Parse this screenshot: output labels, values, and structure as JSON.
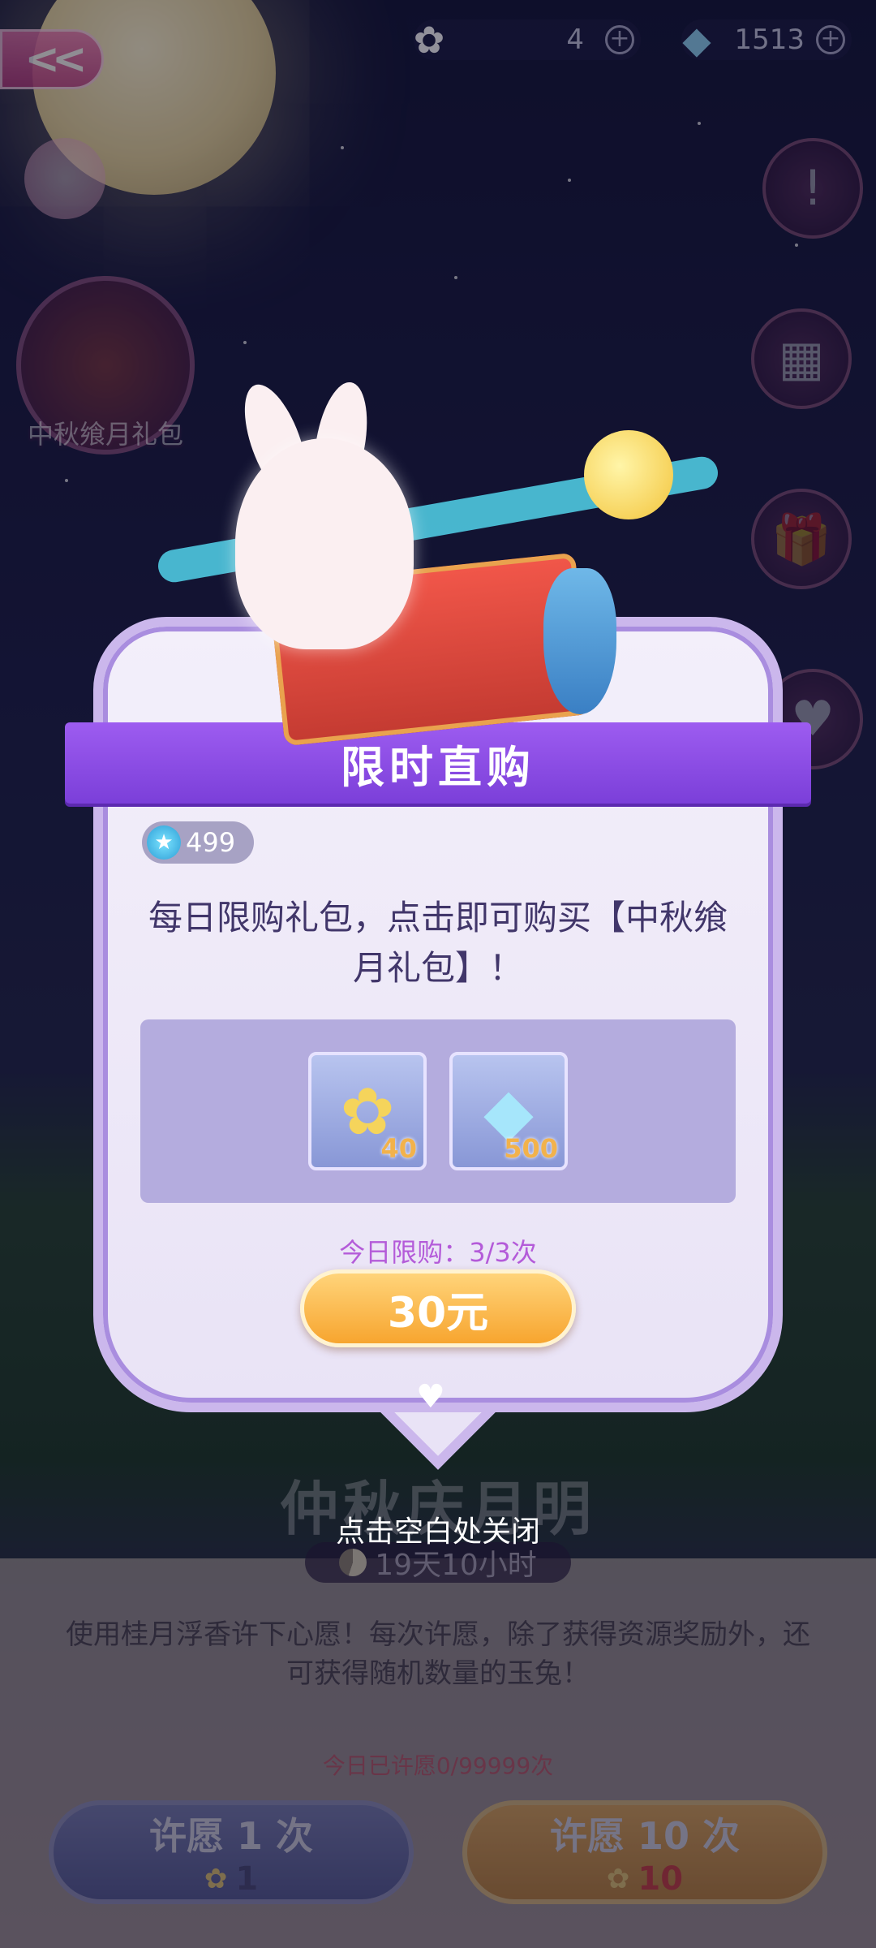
{
  "topbar": {
    "flower_count": "4",
    "gem_count": "1513",
    "flower_icon": "osmanthus-flower-icon",
    "gem_icon": "diamond-icon"
  },
  "side": {
    "gift_pack_label": "中秋飨月礼包"
  },
  "modal": {
    "title": "限时直购",
    "price_tag": "499",
    "description": "每日限购礼包，点击即可购买【中秋飨月礼包】！",
    "rewards": [
      {
        "icon": "osmanthus-flower-icon",
        "qty": "40"
      },
      {
        "icon": "diamond-icon",
        "qty": "500"
      }
    ],
    "limit_text": "今日限购：3/3次",
    "buy_label": "30元"
  },
  "close_hint": "点击空白处关闭",
  "event": {
    "title": "仲秋庆月明",
    "timer": "19天10小时",
    "description": "使用桂月浮香许下心愿！每次许愿，除了获得资源奖励外，还可获得随机数量的玉兔！",
    "wish_count": "今日已许愿0/99999次",
    "wish_once_label": "许愿 1 次",
    "wish_once_cost": "1",
    "wish_ten_label": "许愿 10 次",
    "wish_ten_cost": "10"
  },
  "colors": {
    "ribbon": "#8a4be6",
    "buy_button": "#f7a52f",
    "modal_bg": "#efeaf8"
  }
}
